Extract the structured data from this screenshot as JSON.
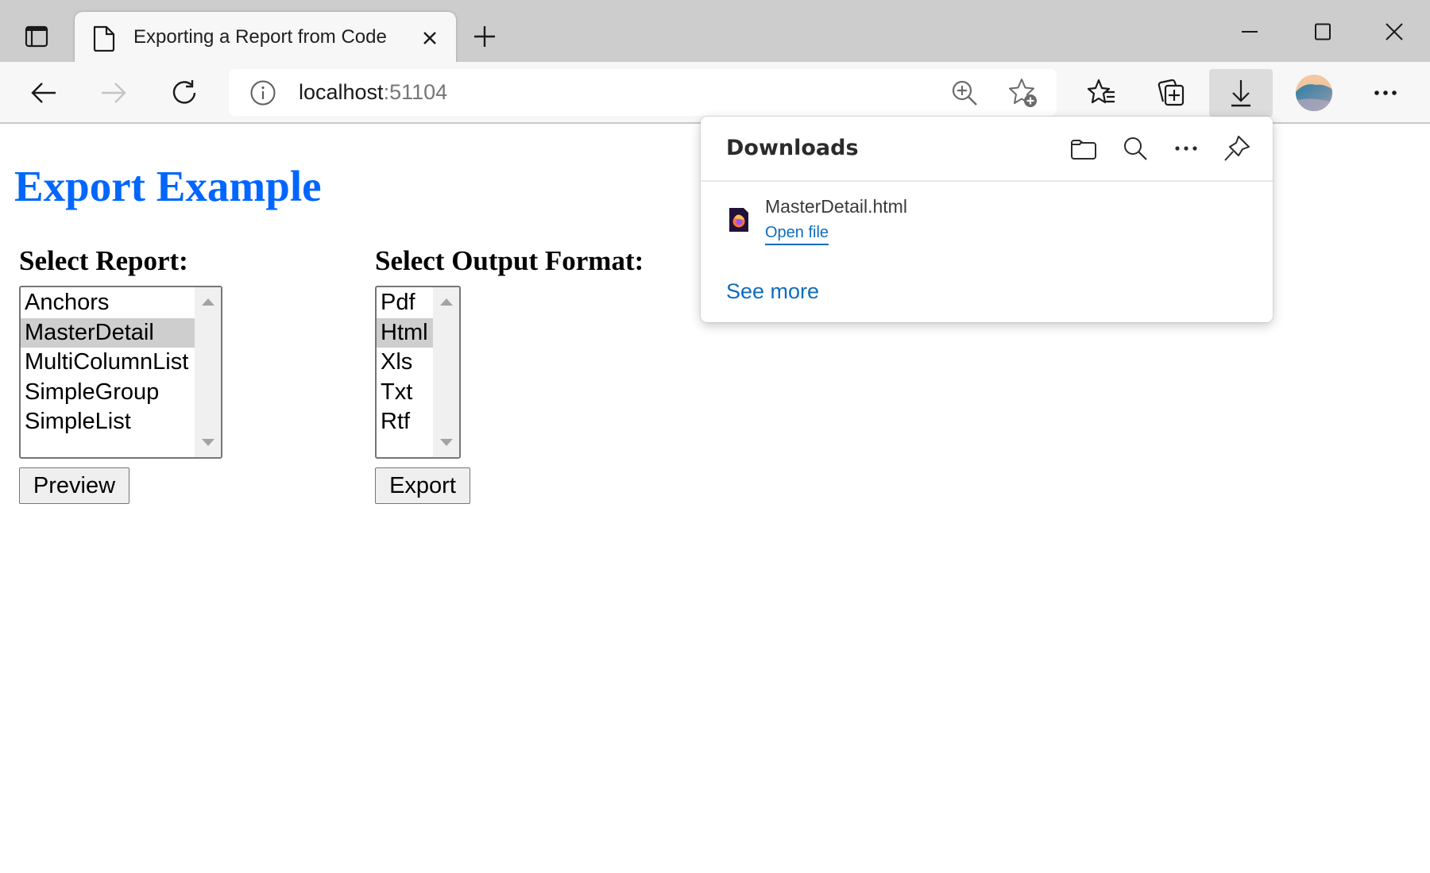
{
  "window": {
    "tab": {
      "title": "Exporting a Report from Code",
      "icon": "document-icon"
    },
    "controls": [
      "minimize-icon",
      "maximize-icon",
      "close-icon"
    ]
  },
  "toolbar": {
    "url_host": "localhost",
    "url_port": ":51104",
    "icons": [
      "back-icon",
      "forward-icon",
      "refresh-icon",
      "info-icon",
      "zoom-icon",
      "add-favorite-icon",
      "favorites-icon",
      "collections-icon",
      "downloads-icon",
      "profile-avatar",
      "more-icon"
    ]
  },
  "page": {
    "title": "Export Example",
    "report_label": "Select Report:",
    "reports": [
      "Anchors",
      "MasterDetail",
      "MultiColumnList",
      "SimpleGroup",
      "SimpleList"
    ],
    "selected_report": "MasterDetail",
    "format_label": "Select Output Format:",
    "formats": [
      "Pdf",
      "Html",
      "Xls",
      "Txt",
      "Rtf"
    ],
    "selected_format": "Html",
    "preview_label": "Preview",
    "export_label": "Export"
  },
  "downloads": {
    "title": "Downloads",
    "header_icons": [
      "folder-icon",
      "search-icon",
      "more-icon",
      "pin-icon"
    ],
    "items": [
      {
        "filename": "MasterDetail.html",
        "action": "Open file",
        "icon": "firefox-file-icon"
      }
    ],
    "see_more": "See more",
    "accent": "#0f6cbd"
  }
}
